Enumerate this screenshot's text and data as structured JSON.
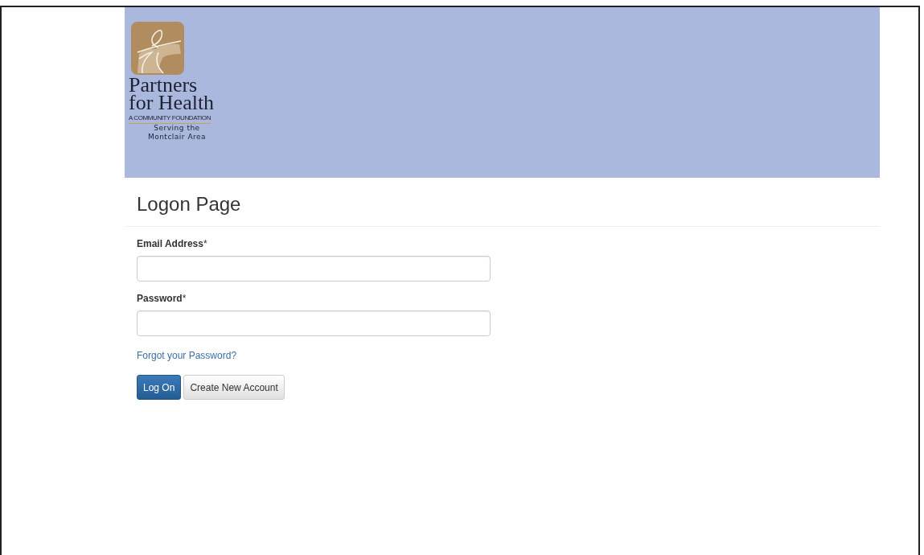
{
  "logo": {
    "name_line_1": "Partners",
    "name_line_2": "for Health",
    "tagline": "A COMMUNITY FOUNDATION",
    "area_line_1": "Serving the",
    "area_line_2": "Montclair Area"
  },
  "title": "Logon Page",
  "fields": [
    {
      "label": "Email Address",
      "required_mark": "*"
    },
    {
      "label": "Password",
      "required_mark": "*"
    }
  ],
  "forgot_link": "Forgot your Password?",
  "buttons": [
    {
      "label": "Log On",
      "kind": "primary"
    },
    {
      "label": "Create New Account",
      "kind": "default"
    }
  ]
}
